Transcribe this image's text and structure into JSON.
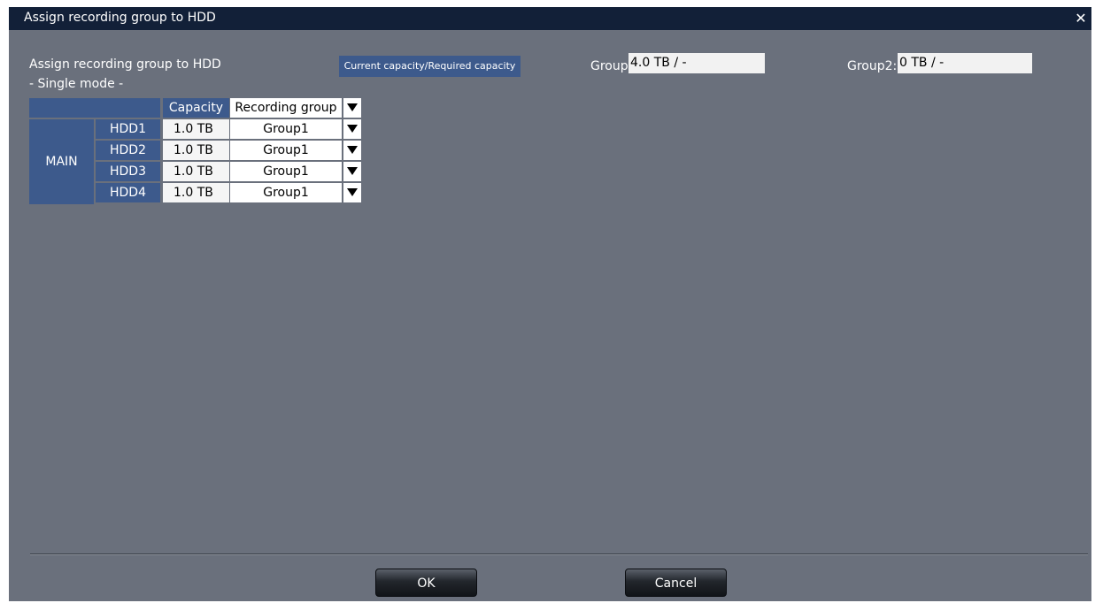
{
  "window": {
    "title": "Assign recording group to HDD"
  },
  "section_title": "Assign recording group to HDD",
  "mode_label": "- Single mode -",
  "capacity_header": "Current capacity/Required capacity",
  "groups": [
    {
      "label": "Group1:",
      "value": "4.0  TB / -"
    },
    {
      "label": "Group2:",
      "value": "0  TB / -"
    }
  ],
  "table": {
    "col_capacity": "Capacity",
    "col_group": "Recording group",
    "row_group_label": "MAIN",
    "rows": [
      {
        "hdd": "HDD1",
        "capacity": "1.0  TB",
        "group": "Group1"
      },
      {
        "hdd": "HDD2",
        "capacity": "1.0  TB",
        "group": "Group1"
      },
      {
        "hdd": "HDD3",
        "capacity": "1.0  TB",
        "group": "Group1"
      },
      {
        "hdd": "HDD4",
        "capacity": "1.0  TB",
        "group": "Group1"
      }
    ]
  },
  "buttons": {
    "ok": "OK",
    "cancel": "Cancel"
  },
  "colors": {
    "title_bar": "#122038",
    "panel": "#6a707c",
    "header_cell": "#3d5a8c"
  }
}
